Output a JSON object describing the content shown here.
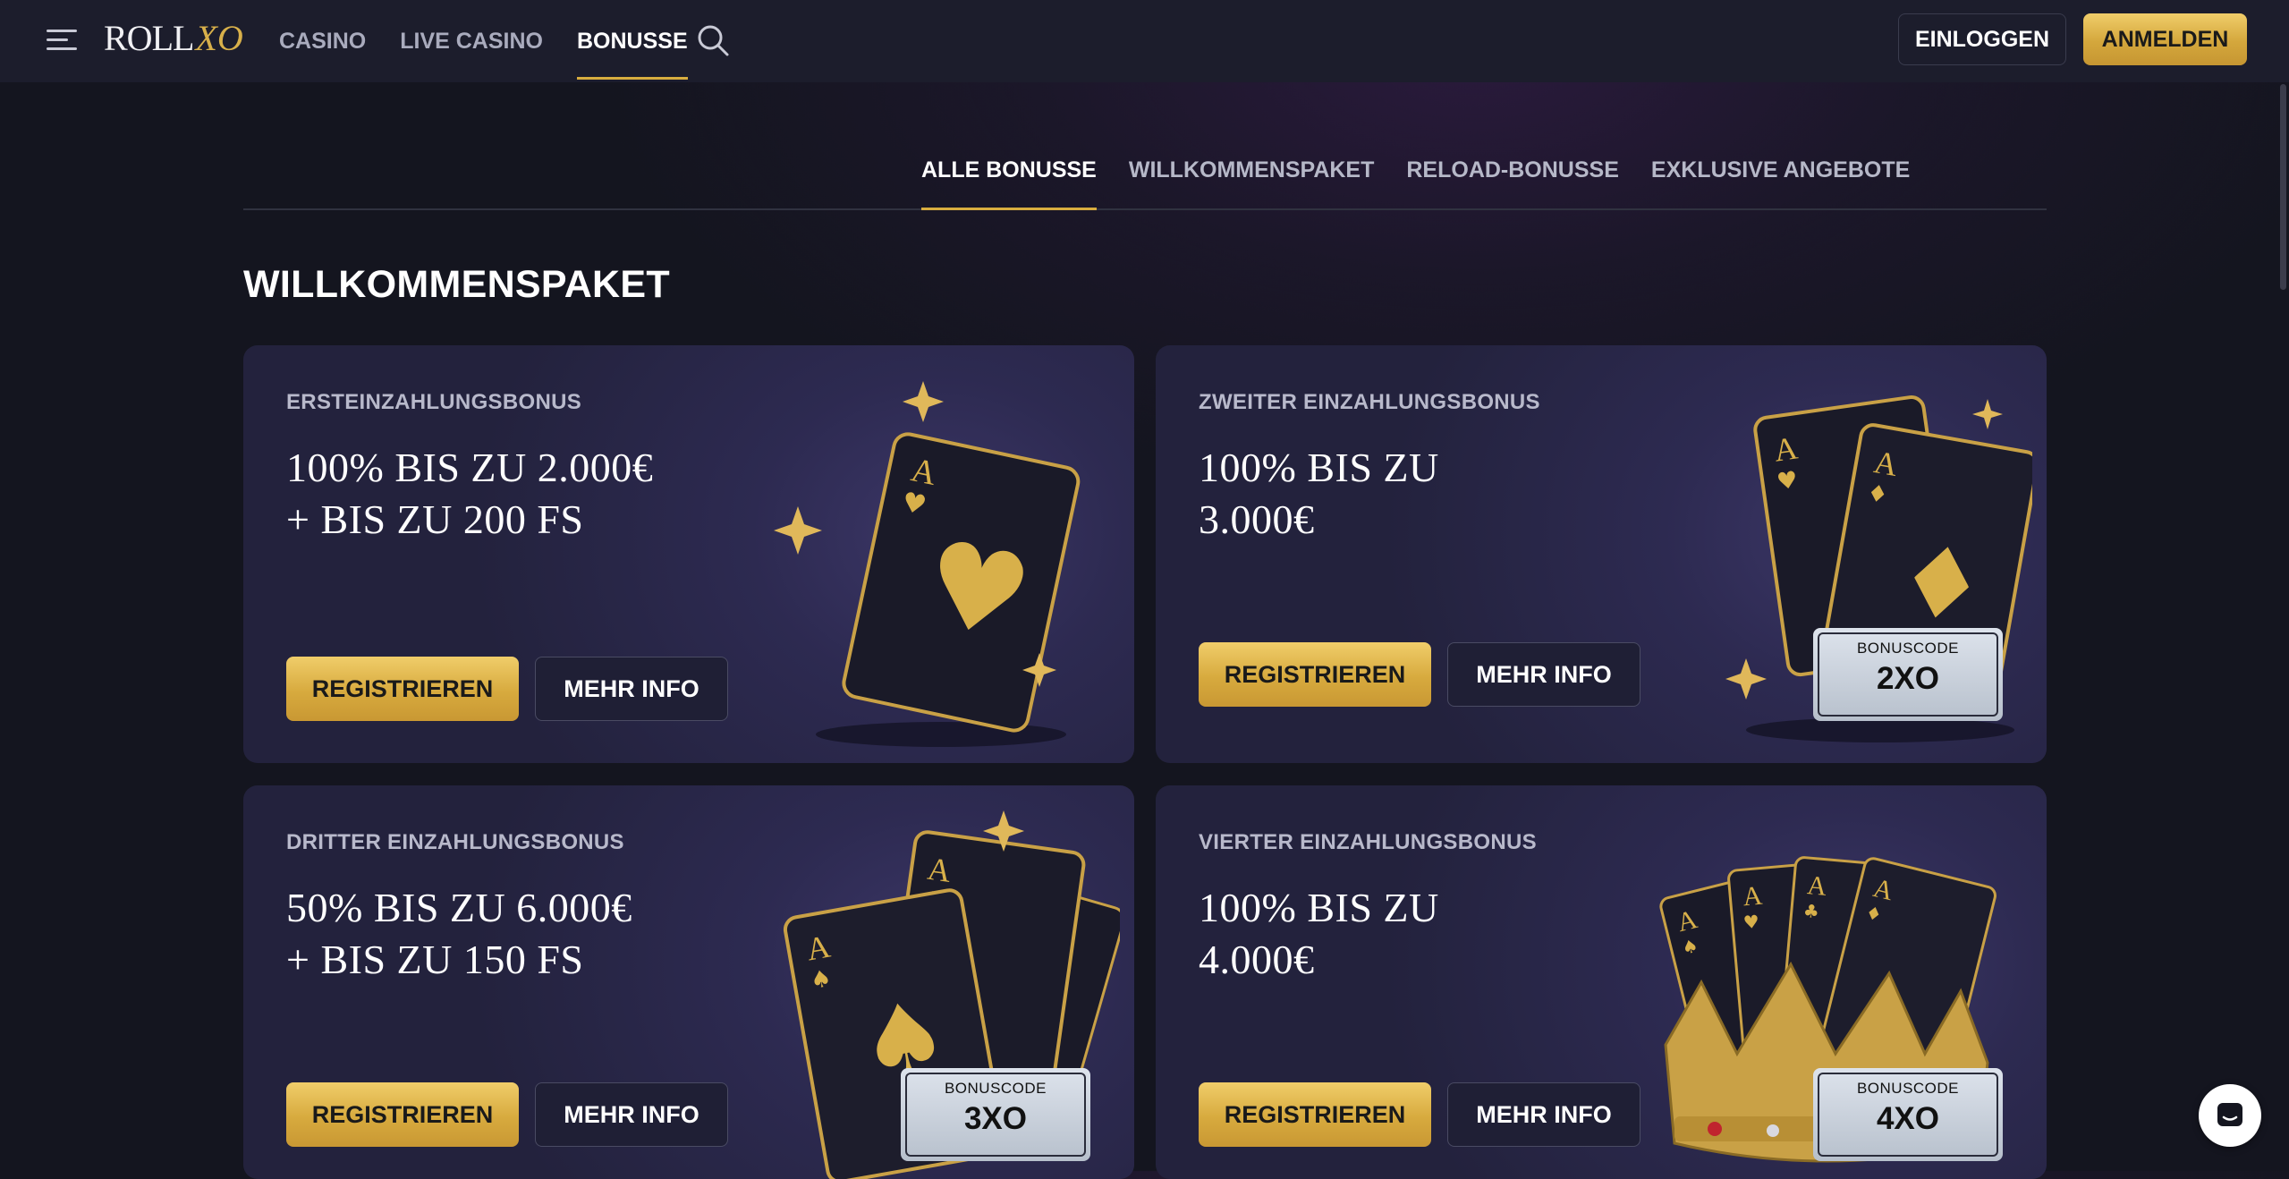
{
  "header": {
    "logo_roll": "ROLL",
    "logo_xo": "XO",
    "nav": [
      {
        "label": "CASINO"
      },
      {
        "label": "LIVE CASINO"
      },
      {
        "label": "BONUSSE",
        "active": true
      }
    ],
    "login_label": "EINLOGGEN",
    "register_label": "ANMELDEN"
  },
  "subtabs": [
    {
      "label": "ALLE BONUSSE",
      "active": true
    },
    {
      "label": "WILLKOMMENSPAKET"
    },
    {
      "label": "RELOAD-BONUSSE"
    },
    {
      "label": "EXKLUSIVE ANGEBOTE"
    }
  ],
  "section_title": "WILLKOMMENSPAKET",
  "cards": [
    {
      "label": "ERSTEINZAHLUNGSBONUS",
      "line1": "100% BIS ZU 2.000€",
      "line2": "+ BIS ZU 200 FS",
      "register_label": "REGISTRIEREN",
      "info_label": "MEHR INFO",
      "art": "single-ace-of-hearts-icon"
    },
    {
      "label": "ZWEITER EINZAHLUNGSBONUS",
      "line1": "100% BIS ZU",
      "line2": "3.000€",
      "register_label": "REGISTRIEREN",
      "info_label": "MEHR INFO",
      "bonuscode_label": "BONUSCODE",
      "bonuscode": "2XO",
      "art": "two-aces-icon"
    },
    {
      "label": "DRITTER EINZAHLUNGSBONUS",
      "line1": "50% BIS ZU 6.000€",
      "line2": "+ BIS ZU 150 FS",
      "register_label": "REGISTRIEREN",
      "info_label": "MEHR INFO",
      "bonuscode_label": "BONUSCODE",
      "bonuscode": "3XO",
      "art": "three-aces-icon"
    },
    {
      "label": "VIERTER EINZAHLUNGSBONUS",
      "line1": "100% BIS ZU",
      "line2": "4.000€",
      "register_label": "REGISTRIEREN",
      "info_label": "MEHR INFO",
      "bonuscode_label": "BONUSCODE",
      "bonuscode": "4XO",
      "art": "four-aces-crown-icon"
    }
  ],
  "card_art_glyphs": {
    "ace": "A",
    "heart": "♥",
    "diamond": "♦",
    "spade": "♠",
    "club": "♣"
  },
  "colors": {
    "accent_gold": "#d8ad3f",
    "background": "#14151f",
    "header": "#1c1d2c",
    "card": "#2d2a51"
  }
}
